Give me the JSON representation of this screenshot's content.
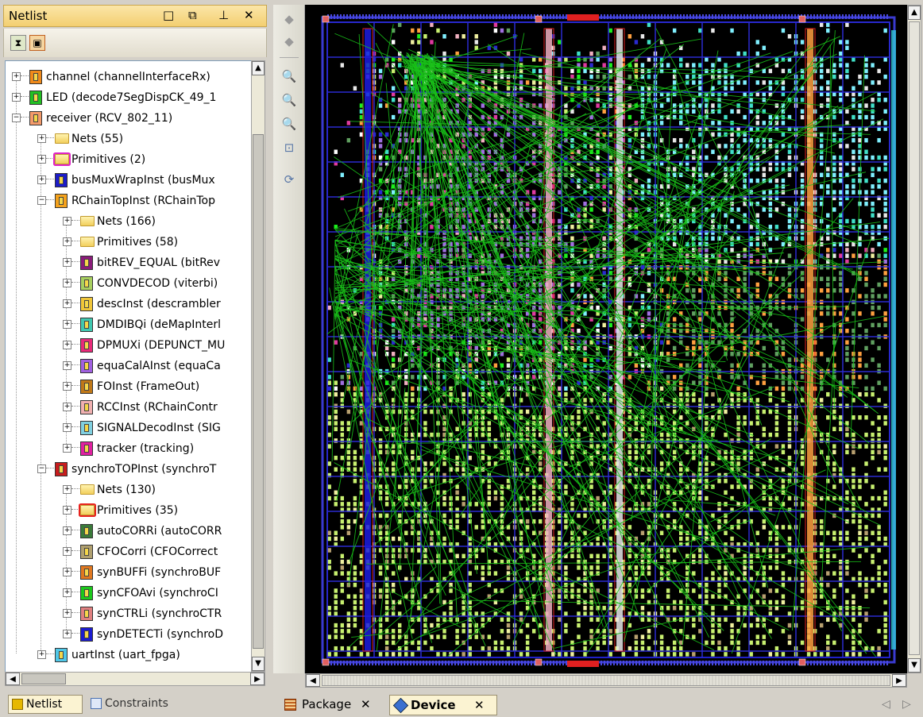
{
  "netlist_panel": {
    "title": "Netlist",
    "window_buttons": [
      "□",
      "⧉",
      "⊥",
      "✕"
    ],
    "toolbar": [
      {
        "icon": "hourglass-icon"
      },
      {
        "icon": "filter-icon"
      }
    ],
    "tree": [
      {
        "level": 0,
        "expander": "+",
        "icon": "block",
        "color": "#f08a1a",
        "label": "channel (channelInterfaceRx)"
      },
      {
        "level": 0,
        "expander": "+",
        "icon": "block",
        "color": "#22c022",
        "label": "LED (decode7SegDispCK_49_1"
      },
      {
        "level": 0,
        "expander": "−",
        "icon": "block",
        "color": "#f39a6a",
        "label": "receiver (RCV_802_11)"
      },
      {
        "level": 1,
        "expander": "+",
        "icon": "folder",
        "folder": "plain",
        "label": "Nets (55)"
      },
      {
        "level": 1,
        "expander": "+",
        "icon": "folder",
        "folder": "magenta",
        "label": "Primitives (2)"
      },
      {
        "level": 1,
        "expander": "+",
        "icon": "block",
        "color": "#1c1cc8",
        "label": "busMuxWrapInst (busMux"
      },
      {
        "level": 1,
        "expander": "−",
        "icon": "block",
        "color": "#f5a21c",
        "label": "RChainTopInst (RChainTop"
      },
      {
        "level": 2,
        "expander": "+",
        "icon": "folder",
        "folder": "plain",
        "label": "Nets (166)"
      },
      {
        "level": 2,
        "expander": "+",
        "icon": "folder",
        "folder": "plain",
        "label": "Primitives (58)"
      },
      {
        "level": 2,
        "expander": "+",
        "icon": "block",
        "color": "#8a1c7a",
        "label": "bitREV_EQUAL (bitRev"
      },
      {
        "level": 2,
        "expander": "+",
        "icon": "block",
        "color": "#a8d060",
        "label": "CONVDECOD (viterbi)"
      },
      {
        "level": 2,
        "expander": "+",
        "icon": "block",
        "color": "#f0c63a",
        "label": "descInst (descrambler"
      },
      {
        "level": 2,
        "expander": "+",
        "icon": "block",
        "color": "#40c8b0",
        "label": "DMDIBQi (deMapInterl"
      },
      {
        "level": 2,
        "expander": "+",
        "icon": "block",
        "color": "#e82a7a",
        "label": "DPMUXi (DEPUNCT_MU"
      },
      {
        "level": 2,
        "expander": "+",
        "icon": "block",
        "color": "#a060e0",
        "label": "equaCalAInst (equaCa"
      },
      {
        "level": 2,
        "expander": "+",
        "icon": "block",
        "color": "#c07818",
        "label": "FOInst (FrameOut)"
      },
      {
        "level": 2,
        "expander": "+",
        "icon": "block",
        "color": "#f0b0b0",
        "label": "RCCInst (RChainContr"
      },
      {
        "level": 2,
        "expander": "+",
        "icon": "block",
        "color": "#80d0e0",
        "label": "SIGNALDecodInst (SIG"
      },
      {
        "level": 2,
        "expander": "+",
        "icon": "block",
        "color": "#e020a0",
        "label": "tracker (tracking)"
      },
      {
        "level": 1,
        "expander": "−",
        "icon": "block",
        "color": "#c81c1c",
        "label": "synchroTOPInst (synchroT"
      },
      {
        "level": 2,
        "expander": "+",
        "icon": "folder",
        "folder": "plain",
        "label": "Nets (130)"
      },
      {
        "level": 2,
        "expander": "+",
        "icon": "folder",
        "folder": "red",
        "label": "Primitives (35)"
      },
      {
        "level": 2,
        "expander": "+",
        "icon": "block",
        "color": "#3a7a3a",
        "label": "autoCORRi (autoCORR"
      },
      {
        "level": 2,
        "expander": "+",
        "icon": "block",
        "color": "#b0a070",
        "label": "CFOCorri (CFOCorrect"
      },
      {
        "level": 2,
        "expander": "+",
        "icon": "block",
        "color": "#e07820",
        "label": "synBUFFi (synchroBUF"
      },
      {
        "level": 2,
        "expander": "+",
        "icon": "block",
        "color": "#1cc81c",
        "label": "synCFOAvi (synchroCI"
      },
      {
        "level": 2,
        "expander": "+",
        "icon": "block",
        "color": "#e08080",
        "label": "synCTRLi (synchroCTR"
      },
      {
        "level": 2,
        "expander": "+",
        "icon": "block",
        "color": "#1c1cd0",
        "label": "synDETECTi (synchroD"
      },
      {
        "level": 1,
        "expander": "+",
        "icon": "block",
        "color": "#50c8e8",
        "label": "uartInst (uart_fpga)"
      }
    ],
    "bottom_tabs": [
      {
        "label": "Netlist",
        "icon": "netlist-icon",
        "active": true
      },
      {
        "label": "Constraints",
        "icon": "constraints-icon",
        "active": false
      }
    ]
  },
  "device_view": {
    "vertical_toolbar": [
      {
        "icon": "back-arrow-icon",
        "glyph": "◆"
      },
      {
        "icon": "forward-arrow-icon",
        "glyph": "◆"
      },
      {
        "icon": "zoom-in-icon",
        "glyph": "🔍"
      },
      {
        "icon": "zoom-out-icon",
        "glyph": "🔍"
      },
      {
        "icon": "zoom-selection-icon",
        "glyph": "🔍"
      },
      {
        "icon": "zoom-fit-icon",
        "glyph": "⊡"
      },
      {
        "icon": "refresh-icon",
        "glyph": "⟳"
      }
    ],
    "palette": [
      "#a070e0",
      "#e03aa0",
      "#80f0ff",
      "#40e0c8",
      "#ffa040",
      "#c8f070",
      "#f0f0a0",
      "#ffffff",
      "#f0b0c0",
      "#60a060",
      "#2a2ad0",
      "#1cf01c",
      "#e8e8e8"
    ],
    "tabs": [
      {
        "label": "Package",
        "icon": "package-icon",
        "active": false
      },
      {
        "label": "Device",
        "icon": "device-icon",
        "active": true
      }
    ]
  }
}
